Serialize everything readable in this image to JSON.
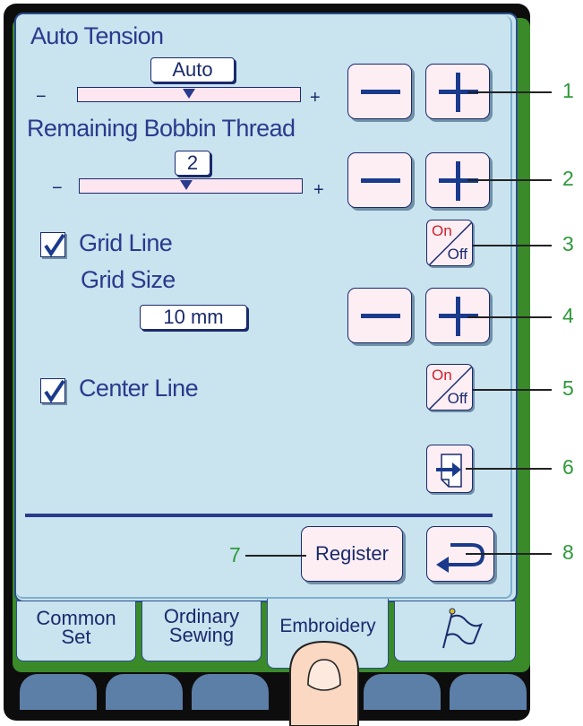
{
  "screen": {
    "auto_tension": {
      "title": "Auto Tension",
      "value": "Auto",
      "minus_sign": "−",
      "plus_sign": "+",
      "level": 0.5
    },
    "bobbin": {
      "title": "Remaining Bobbin Thread",
      "value": "2",
      "minus_sign": "−",
      "plus_sign": "+",
      "level": 0.48
    },
    "grid_line": {
      "label": "Grid Line",
      "checked": true,
      "toggle_on": "On",
      "toggle_off": "Off"
    },
    "grid_size": {
      "label": "Grid Size",
      "value": "10 mm"
    },
    "center_line": {
      "label": "Center Line",
      "checked": true,
      "toggle_on": "On",
      "toggle_off": "Off"
    },
    "register_label": "Register",
    "next_page_icon": "page-arrow-icon",
    "return_icon": "return-arrow-icon"
  },
  "tabs": [
    {
      "line1": "Common",
      "line2": "Set"
    },
    {
      "line1": "Ordinary",
      "line2": "Sewing"
    },
    {
      "line1": "Embroidery",
      "line2": ""
    },
    {
      "icon": "flag-icon"
    }
  ],
  "callouts": [
    "1",
    "2",
    "3",
    "4",
    "5",
    "6",
    "7",
    "8"
  ],
  "colors": {
    "screen_bg": "#c9e3ef",
    "text": "#2a3a8c",
    "button_bg": "#fdeef4",
    "on_text": "#d0202a",
    "callout": "#2e9a3a"
  }
}
